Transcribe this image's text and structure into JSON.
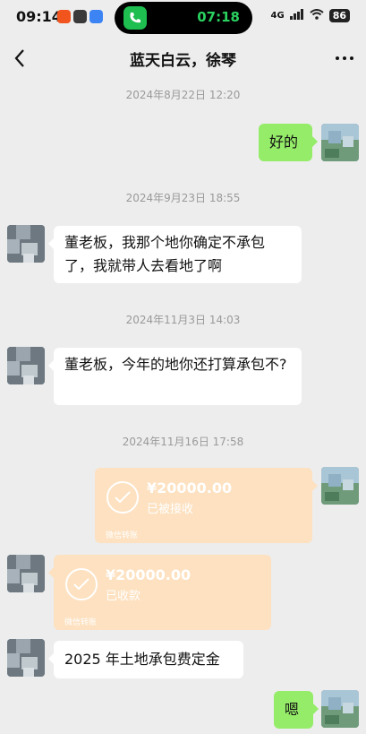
{
  "status_bar": {
    "time": "09:14",
    "call_time": "07:18",
    "network": "4G",
    "battery": "86"
  },
  "nav": {
    "title": "蓝天白云，徐琴"
  },
  "messages": [
    {
      "timestamp": "2024年8月22日 12:20"
    },
    {
      "text": "好的"
    },
    {
      "timestamp": "2024年9月23日 18:55"
    },
    {
      "text": "董老板，我那个地你确定不承包了，我就带人去看地了啊"
    },
    {
      "timestamp": "2024年11月3日 14:03"
    },
    {
      "text": "董老板，今年的地你还打算承包不?"
    },
    {
      "timestamp": "2024年11月16日 17:58"
    },
    {
      "amount": "¥20000.00",
      "status": "已被接收",
      "label": "微信转账"
    },
    {
      "amount": "¥20000.00",
      "status": "已收款",
      "label": "微信转账"
    },
    {
      "text": "2025 年土地承包费定金"
    },
    {
      "text": "嗯"
    }
  ],
  "colors": {
    "background": "#ededed",
    "outgoing_bubble": "#95ec69",
    "incoming_bubble": "#ffffff",
    "transfer_card": "#fde1c0",
    "call_green": "#1fbe51"
  }
}
